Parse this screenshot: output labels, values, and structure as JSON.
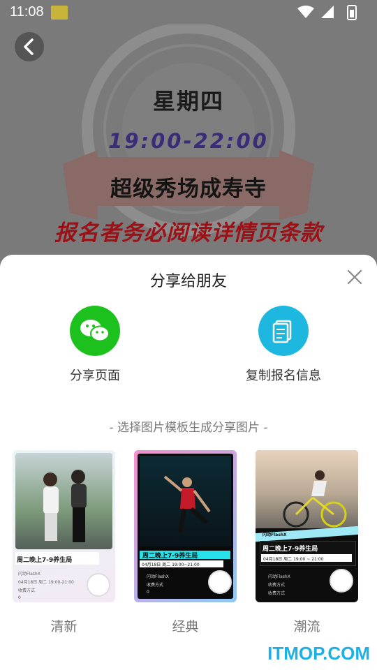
{
  "status_bar": {
    "time": "11:08"
  },
  "hero": {
    "day": "星期四",
    "time_range": "19:00-22:00",
    "venue": "超级秀场成寿寺",
    "notice": "报名者务必阅读详情页条款"
  },
  "share_sheet": {
    "title": "分享给朋友",
    "options": [
      {
        "label": "分享页面",
        "icon": "wechat-icon",
        "color": "#1dc11d"
      },
      {
        "label": "复制报名信息",
        "icon": "copy-icon",
        "color": "#1db7e0"
      }
    ],
    "template_hint": "- 选择图片模板生成分享图片 -",
    "templates": [
      {
        "label": "清新",
        "card_title": "周二晚上7-9养生局",
        "lines": [
          "闪动FlashX",
          "04月18日 周二 19:00-21:00",
          "收费方式",
          "0"
        ]
      },
      {
        "label": "经典",
        "card_title": "周二晚上7-9养生局",
        "date_line": "04月18日 周二 19:00~21:00",
        "lines": [
          "闪动FlashX",
          "收费方式",
          "0"
        ]
      },
      {
        "label": "潮流",
        "card_title": "周二晚上7-9养生局",
        "date_line": "04月18日 周二  19:00  ~  21:00",
        "banner": "闪动FlashX",
        "lines": [
          "闪动FlashX",
          "收费方式",
          "收费方式"
        ]
      }
    ]
  },
  "watermark": "ITMOP.COM"
}
